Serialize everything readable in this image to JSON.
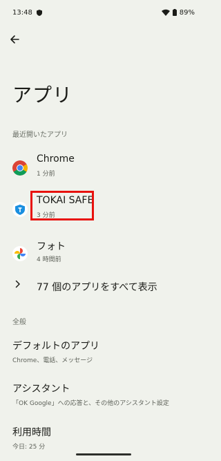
{
  "status_bar": {
    "time": "13:48",
    "battery": "89%"
  },
  "page": {
    "title": "アプリ"
  },
  "recent": {
    "section_label": "最近開いたアプリ",
    "apps": [
      {
        "name": "Chrome",
        "time": "1 分前",
        "icon": "chrome-icon"
      },
      {
        "name": "TOKAI SAFE",
        "time": "3 分前",
        "icon": "tokai-safe-icon"
      },
      {
        "name": "フォト",
        "time": "4 時間前",
        "icon": "photos-icon"
      }
    ],
    "show_all_label": "77 個のアプリをすべて表示"
  },
  "general": {
    "section_label": "全般",
    "items": [
      {
        "title": "デフォルトのアプリ",
        "subtitle": "Chrome、電話、メッセージ"
      },
      {
        "title": "アシスタント",
        "subtitle": "「OK Google」への応答と、その他のアシスタント設定"
      },
      {
        "title": "利用時間",
        "subtitle": "今日: 25 分"
      }
    ]
  },
  "colors": {
    "background": "#f0f2ec",
    "highlight": "#e8120d"
  }
}
